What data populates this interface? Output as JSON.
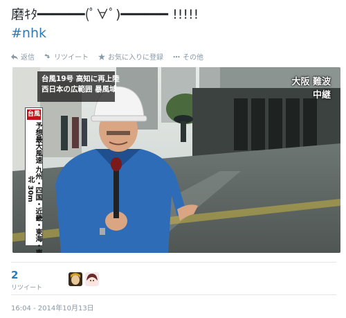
{
  "tweet": {
    "text": "磨ｷﾀ━━━━━━(ﾟ∀ﾟ)━━━━━━ !!!!!",
    "hashtag": "#nhk"
  },
  "actions": [
    {
      "icon": "reply-icon",
      "label": "返信"
    },
    {
      "icon": "retweet-icon",
      "label": "リツイート"
    },
    {
      "icon": "star-icon",
      "label": "お気に入りに登録"
    },
    {
      "icon": "more-icon",
      "label": "その他"
    }
  ],
  "media": {
    "ticker_line1": "台風19号 高知に再上陸",
    "ticker_line2": "西日本の広範囲 暴風域",
    "location_line1": "大阪 難波",
    "location_line2": "中継",
    "side_header": "台風",
    "side_text": "予想最大風速 九州・四国・近畿・東海・東北 30m"
  },
  "stats": {
    "retweet_count": "2",
    "retweet_label": "リツイート"
  },
  "timestamp": "16:04 - 2014年10月13日",
  "colors": {
    "link": "#2b7bb9",
    "muted": "#8899a6",
    "text": "#292f33"
  }
}
